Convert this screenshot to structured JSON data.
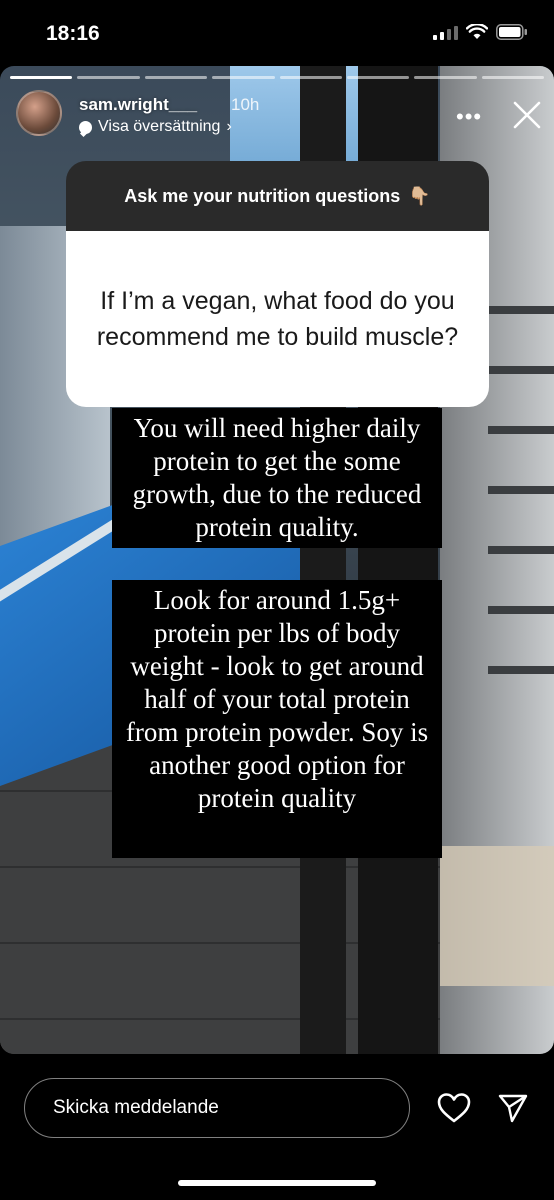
{
  "status_bar": {
    "time": "18:16"
  },
  "story": {
    "progress_segments": 8,
    "progress_active": 1,
    "username": "sam.wright___",
    "time_ago": "10h",
    "translate_label": "Visa översättning",
    "translate_chevron": "›",
    "more_glyph": "•••",
    "question_prompt": "Ask me your nutrition questions",
    "question_prompt_emoji": "👇🏼",
    "question_text": "If I’m a vegan, what food do you recommend me to build muscle?",
    "answer_1": "You will need higher daily protein to get the some growth, due to the reduced protein quality.",
    "answer_2": "Look for around 1.5g+ protein per lbs of body weight - look to get around half of your total protein from protein powder. Soy is another good option for protein quality"
  },
  "footer": {
    "message_placeholder": "Skicka meddelande"
  },
  "icons": {
    "more": "more-dots-icon",
    "close": "close-icon",
    "like": "heart-icon",
    "send": "send-icon",
    "translate": "chat-bubble-icon"
  }
}
